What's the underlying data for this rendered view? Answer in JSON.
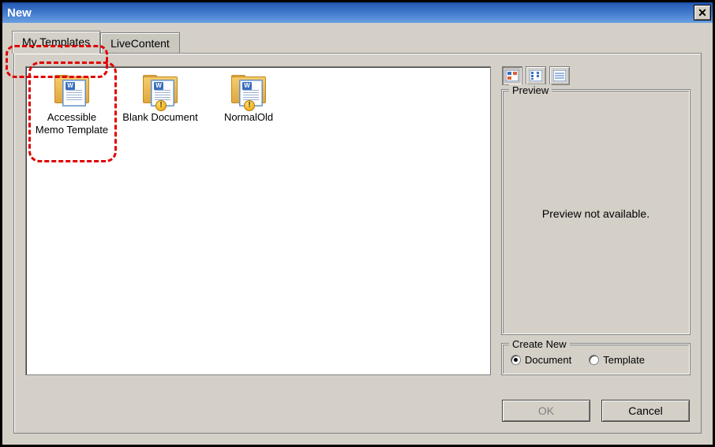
{
  "window": {
    "title": "New",
    "close_glyph": "✕"
  },
  "tabs": [
    {
      "label": "My Templates",
      "active": true
    },
    {
      "label": "LiveContent",
      "active": false
    }
  ],
  "templates": [
    {
      "label": "Accessible Memo Template",
      "badge": "W",
      "warning": false
    },
    {
      "label": "Blank Document",
      "badge": "W",
      "warning": true
    },
    {
      "label": "NormalOld",
      "badge": "W",
      "warning": true
    }
  ],
  "view_buttons": {
    "large_icons": "view-large-icons",
    "list": "view-list",
    "details": "view-details"
  },
  "preview": {
    "title": "Preview",
    "message": "Preview not available."
  },
  "create_new": {
    "title": "Create New",
    "document_label": "Document",
    "template_label": "Template",
    "selected": "document"
  },
  "buttons": {
    "ok": "OK",
    "cancel": "Cancel"
  }
}
